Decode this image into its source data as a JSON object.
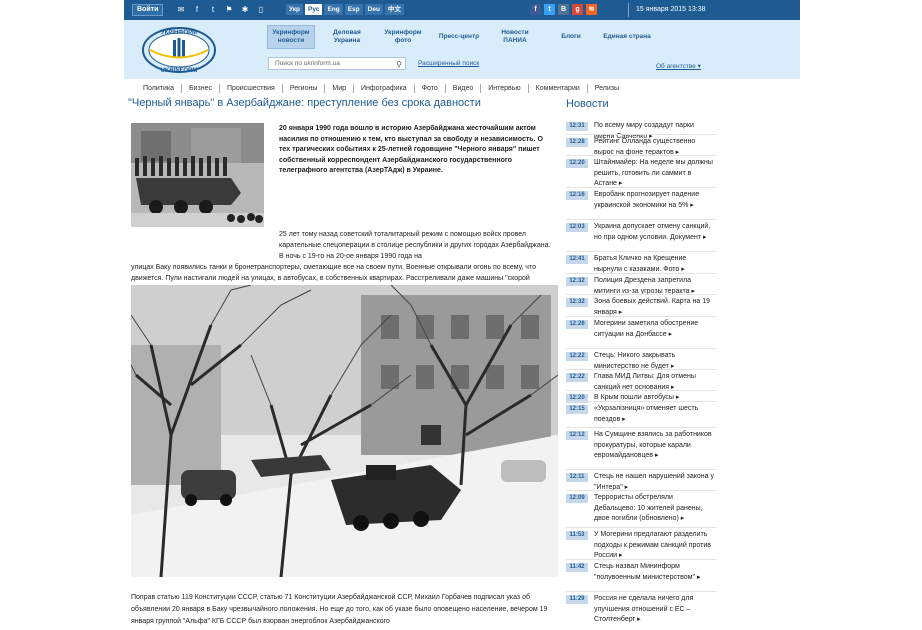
{
  "topbar": {
    "login_label": "Войти",
    "languages": [
      {
        "label": "Укр",
        "active": false
      },
      {
        "label": "Рус",
        "active": true
      },
      {
        "label": "Eng",
        "active": false
      },
      {
        "label": "Esp",
        "active": false
      },
      {
        "label": "Deu",
        "active": false
      },
      {
        "label": "中文",
        "active": false
      }
    ],
    "social_icons": [
      "facebook-icon",
      "twitter-icon",
      "vk-icon",
      "googleplus-icon",
      "rss-icon"
    ],
    "datetime": "15 января 2015 13:38"
  },
  "header": {
    "logo_top": "УКРІНФОРМ",
    "logo_bottom": "UKRINFORM",
    "nav": [
      {
        "label": "Укринформ новости",
        "active": true
      },
      {
        "label": "Деловая Украина",
        "active": false
      },
      {
        "label": "Укринформ фото",
        "active": false
      },
      {
        "label": "Пресс-центр",
        "active": false
      },
      {
        "label": "Новости ПАНИА",
        "active": false
      },
      {
        "label": "Блоги",
        "active": false
      },
      {
        "label": "Единая страна",
        "active": false
      }
    ],
    "search_placeholder": "Поиск по ukrinform.ua",
    "advanced_search": "Расширенный поиск",
    "about": "Об агентстве"
  },
  "menu": [
    "Политика",
    "Бизнес",
    "Происшествия",
    "Регионы",
    "Мир",
    "Инфографика",
    "Фото",
    "Видео",
    "Интервью",
    "Комментарии",
    "Релизы"
  ],
  "article": {
    "title": "\"Черный январь\" в Азербайджане: преступление без срока давности",
    "lead": "20 января 1990 года вошло в историю Азербайджана жесточайшим актом насилия по отношению к тем, кто выступал за свободу и независимость. О тех трагических событиях к 25-летней годовщине \"Черного января\" пишет собственный корреспондент Азербайджанского государственного телеграфного агентства (АзерТАдж) в Украине.",
    "para1a": "25 лет тому назад советский тоталитарный режим с помощью войск провел карательные спецоперации в столице республики и других городах Азербайджана. В ночь с 19-го на 20-ое января 1990 года на",
    "para1b": "улицах Баку появились танки и бронетранспортеры, сметающие все на своем пути. Военные открывали огонь по всему, что движется. Пули настигали людей на улицах, в автобусах, в собственных квартирах. Расстреливали даже машины \"скорой помощи\", перевозившие раненых и медицинских работников.",
    "para2": "Поправ статью 119 Конституции СССР, статью 71 Конституции Азербайджанской ССР, Михаил Горбачев подписал указ об объявлении 20 января в Баку чрезвычайного положения. Но еще до того, как об указе было оповещено население, вечером 19 января группой \"Альфа\" КГБ СССР был взорван энергоблок Азербайджанского"
  },
  "news": {
    "title": "Новости",
    "items": [
      {
        "time": "12:31",
        "text": "По всему миру создадут парки имени Савченко ▸"
      },
      {
        "time": "12:28",
        "text": "Рейтинг Олланда существенно вырос на фоне терактов ▸"
      },
      {
        "time": "12:20",
        "text": "Штайнмайер: На неделе мы должны решить, готовить ли саммит в Астане ▸"
      },
      {
        "time": "12:16",
        "text": "Евробанк прогнозирует падение украинской экономики на 5% ▸"
      },
      {
        "time": "12:03",
        "text": "Украина допускает отмену санкций, но при одном условии. Документ ▸"
      },
      {
        "time": "12:41",
        "text": "Братья Кличко на Крещение нырнули с казаками. Фото ▸"
      },
      {
        "time": "12:32",
        "text": "Полиция Дрездена запретила митинги из-за угрозы теракта ▸"
      },
      {
        "time": "12:32",
        "text": "Зона боевых действий. Карта на 19 января ▸"
      },
      {
        "time": "12:26",
        "text": "Могерини заметила обострение ситуации на Донбассе ▸"
      },
      {
        "time": "12:22",
        "text": "Стець: Никого закрывать министерство не будет ▸"
      },
      {
        "time": "12:22",
        "text": "Глава МИД Литвы: Для отмены санкций нет основания ▸"
      },
      {
        "time": "12:20",
        "text": "В Крым пошли автобусы ▸"
      },
      {
        "time": "12:15",
        "text": "«Укрзалізниця» отменяет шесть поездов ▸"
      },
      {
        "time": "12:12",
        "text": "На Сумщине взялись за работников прокуратуры, которые карали евромайдановцев ▸"
      },
      {
        "time": "12:11",
        "text": "Стець не нашел нарушений закона у \"Интера\" ▸"
      },
      {
        "time": "12:09",
        "text": "Террористы обстреляли Дебальцево: 10 жителей ранены, двое погибли (обновлено) ▸"
      },
      {
        "time": "11:53",
        "text": "У Могерини предлагают разделить подходы к режимам санкций против России ▸"
      },
      {
        "time": "11:42",
        "text": "Стець назвал Мининформ \"полувоенным министерством\" ▸"
      },
      {
        "time": "11:29",
        "text": "Россия не сделала ничего для улучшения отношений с ЕС – Столтенберг ▸"
      }
    ]
  },
  "colors": {
    "brand_blue": "#1e5b93",
    "header_bg": "#d9ecfa",
    "time_badge": "#c4d8ea"
  }
}
